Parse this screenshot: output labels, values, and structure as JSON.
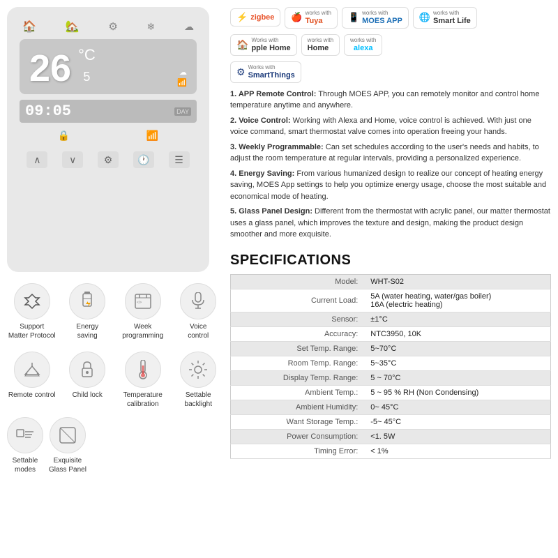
{
  "left": {
    "device": {
      "top_icons": [
        "🏠",
        "🏠",
        "⚙️",
        "❄️",
        "☁️"
      ],
      "temp_main": "26",
      "temp_unit": "°C",
      "temp_set": "5",
      "time": "09:05",
      "time_label": "DAY",
      "mid_icons": [
        "🔒",
        "📶"
      ],
      "bottom_controls": [
        "∧",
        "∨",
        "⚙️",
        "🕐",
        "☰"
      ]
    },
    "features": [
      {
        "icon": "✳️",
        "label": "Support\nMatter Protocol"
      },
      {
        "icon": "🔋",
        "label": "Energy\nsaving"
      },
      {
        "icon": "📋",
        "label": "Week\nprogramming"
      },
      {
        "icon": "🎤",
        "label": "Voice\ncontrol"
      },
      {
        "icon": "🏠",
        "label": "Remote control"
      },
      {
        "icon": "🔒",
        "label": "Child lock"
      },
      {
        "icon": "🌡️",
        "label": "Temperature\ncalibration"
      },
      {
        "icon": "☀️",
        "label": "Settable\nbacklight"
      },
      {
        "icon": "☰",
        "label": "Settable\nmodes"
      },
      {
        "icon": "◻️",
        "label": "Exquisite\nGlass Panel"
      }
    ]
  },
  "right": {
    "badges_row1": [
      {
        "icon": "⚡",
        "text1": "zigbee",
        "text2": ""
      },
      {
        "icon": "🍎",
        "text1": "works with",
        "text2": "Tuya"
      },
      {
        "icon": "📱",
        "text1": "works with",
        "text2": "MOES APP"
      },
      {
        "icon": "🌐",
        "text1": "works with",
        "text2": "Smart Life"
      }
    ],
    "badges_row2": [
      {
        "icon": "🏠",
        "text1": "Works with",
        "text2": "pple Home"
      },
      {
        "icon": "",
        "text1": "works with",
        "text2": "Home"
      },
      {
        "icon": "",
        "text1": "works",
        "text2": "with"
      },
      {
        "icon": "",
        "text1": "alexa",
        "text2": ""
      }
    ],
    "badges_row3": [
      {
        "icon": "⚙️",
        "text1": "Works with",
        "text2": "SmartThings"
      }
    ],
    "description": [
      "1. APP Remote Control: Through MOES APP, you can remotely monitor and control home temperature anytime and anywhere.",
      "2. Voice Control: Working with Alexa and Home, voice control is achieved. With just one voice command, smart thermostat valve comes into operation freeing your hands.",
      "3. Weekly Programmable: Can set schedules according to the user's needs and habits, to adjust the room temperature at regular intervals, providing a personalized experience.",
      "4. Energy Saving: From various humanized design to realize our concept of heating energy saving, MOES App settings to help you optimize energy usage, choose the most suitable and economical mode of heating.",
      "5. Glass Panel Design: Different from the thermostat with acrylic panel, our matter thermostat uses a glass panel, which improves the texture and design, making the product design smoother and more exquisite."
    ],
    "spec_title": "SPECIFICATIONS",
    "specs": [
      {
        "label": "Model:",
        "value": "WHT-S02"
      },
      {
        "label": "Current Load:",
        "value": "5A (water heating, water/gas boiler)\n16A (electric heating)"
      },
      {
        "label": "Sensor:",
        "value": "±1°C"
      },
      {
        "label": "Accuracy:",
        "value": "NTC3950, 10K"
      },
      {
        "label": "Set Temp. Range:",
        "value": "5~70°C"
      },
      {
        "label": "Room Temp. Range:",
        "value": "5~35°C"
      },
      {
        "label": "Display Temp. Range:",
        "value": "5 ~ 70°C"
      },
      {
        "label": "Ambient Temp.:",
        "value": "5 ~ 95 % RH (Non Condensing)"
      },
      {
        "label": "Ambient Humidity:",
        "value": "0~ 45°C"
      },
      {
        "label": "Want Storage Temp.:",
        "value": "-5~ 45°C"
      },
      {
        "label": "Power Consumption:",
        "value": "<1. 5W"
      },
      {
        "label": "Timing Error:",
        "value": "< 1%"
      }
    ]
  }
}
